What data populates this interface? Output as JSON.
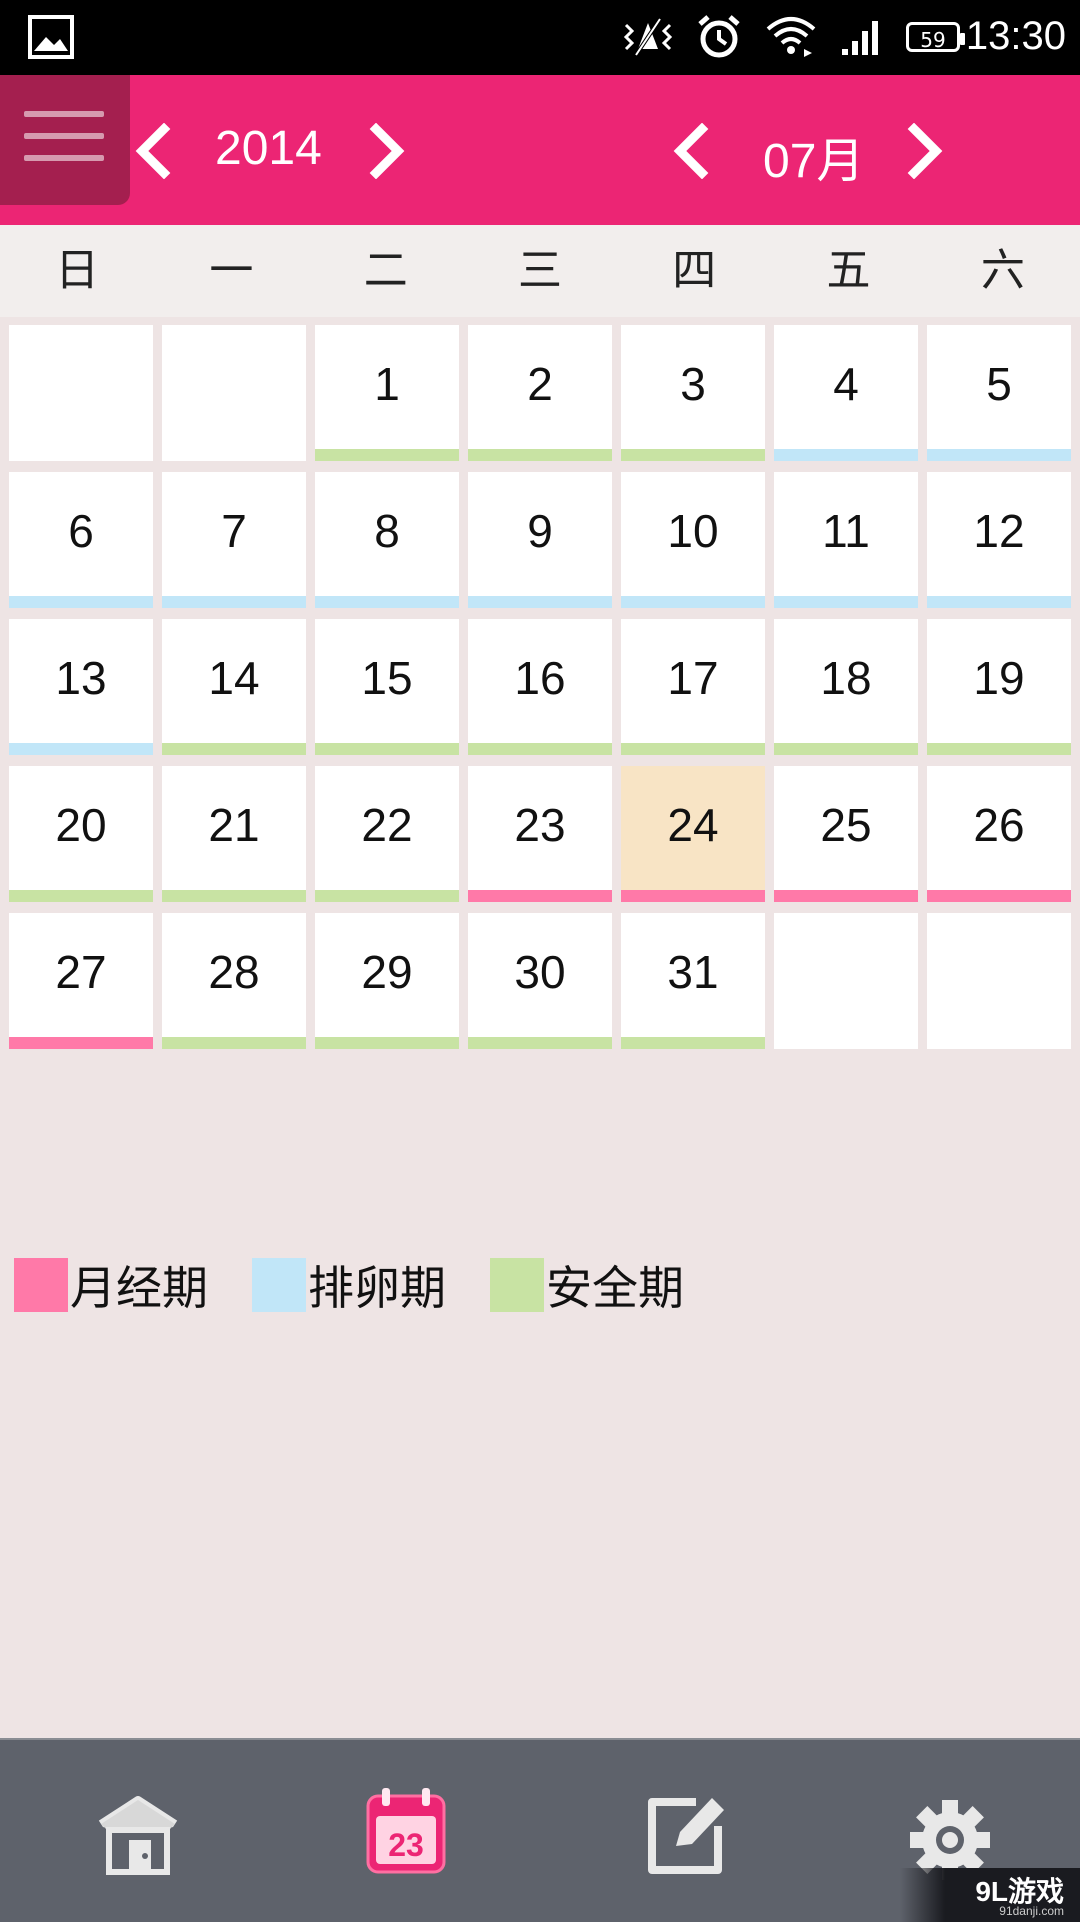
{
  "status_bar": {
    "battery": "59",
    "time": "13:30"
  },
  "header": {
    "year": "2014",
    "month": "07月"
  },
  "colors": {
    "accent": "#ec2574",
    "period": "#ff79a8",
    "ovulation": "#c1e6f8",
    "safe": "#c8e3a3",
    "today_bg": "#f8e4c5"
  },
  "weekdays": [
    "日",
    "一",
    "二",
    "三",
    "四",
    "五",
    "六"
  ],
  "calendar": {
    "first_weekday": 2,
    "days": [
      {
        "day": "1",
        "phase": "safe"
      },
      {
        "day": "2",
        "phase": "safe"
      },
      {
        "day": "3",
        "phase": "safe"
      },
      {
        "day": "4",
        "phase": "ovulation"
      },
      {
        "day": "5",
        "phase": "ovulation"
      },
      {
        "day": "6",
        "phase": "ovulation"
      },
      {
        "day": "7",
        "phase": "ovulation"
      },
      {
        "day": "8",
        "phase": "ovulation"
      },
      {
        "day": "9",
        "phase": "ovulation"
      },
      {
        "day": "10",
        "phase": "ovulation"
      },
      {
        "day": "11",
        "phase": "ovulation"
      },
      {
        "day": "12",
        "phase": "ovulation"
      },
      {
        "day": "13",
        "phase": "ovulation"
      },
      {
        "day": "14",
        "phase": "safe"
      },
      {
        "day": "15",
        "phase": "safe"
      },
      {
        "day": "16",
        "phase": "safe"
      },
      {
        "day": "17",
        "phase": "safe"
      },
      {
        "day": "18",
        "phase": "safe"
      },
      {
        "day": "19",
        "phase": "safe"
      },
      {
        "day": "20",
        "phase": "safe"
      },
      {
        "day": "21",
        "phase": "safe"
      },
      {
        "day": "22",
        "phase": "safe"
      },
      {
        "day": "23",
        "phase": "period"
      },
      {
        "day": "24",
        "phase": "period",
        "today": true
      },
      {
        "day": "25",
        "phase": "period"
      },
      {
        "day": "26",
        "phase": "period"
      },
      {
        "day": "27",
        "phase": "period"
      },
      {
        "day": "28",
        "phase": "safe"
      },
      {
        "day": "29",
        "phase": "safe"
      },
      {
        "day": "30",
        "phase": "safe"
      },
      {
        "day": "31",
        "phase": "safe"
      }
    ]
  },
  "legend": [
    {
      "phase": "period",
      "label": "月经期"
    },
    {
      "phase": "ovulation",
      "label": "排卵期"
    },
    {
      "phase": "safe",
      "label": "安全期"
    }
  ],
  "bottom_tabs": [
    {
      "name": "home-icon"
    },
    {
      "name": "calendar-icon",
      "badge": "23",
      "active": true
    },
    {
      "name": "edit-icon"
    },
    {
      "name": "settings-icon"
    }
  ],
  "watermark": {
    "main": "9L游戏",
    "sub": "91danji.com"
  }
}
